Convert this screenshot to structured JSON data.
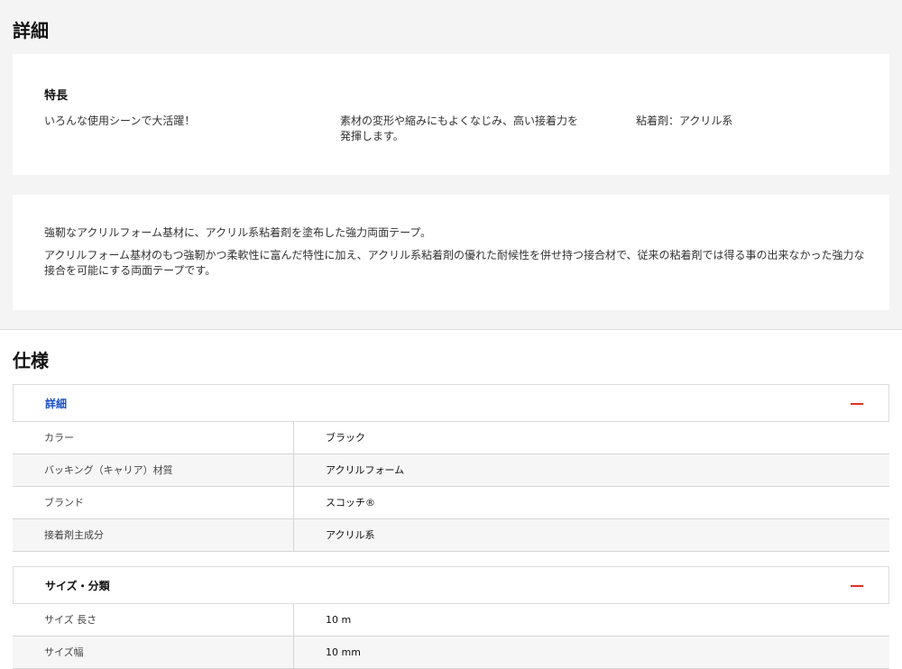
{
  "details": {
    "title": "詳細",
    "features_heading": "特長",
    "features": [
      "いろんな使用シーンで大活躍！",
      "素材の変形や縮みにもよくなじみ、高い接着力を発揮します。",
      "粘着剤：アクリル系"
    ],
    "description": [
      "強靭なアクリルフォーム基材に、アクリル系粘着剤を塗布した強力両面テープ。",
      "アクリルフォーム基材のもつ強靭かつ柔軟性に富んだ特性に加え、アクリル系粘着剤の優れた耐候性を併せ持つ接合材で、従来の粘着剤では得る事の出来なかった強力な接合を可能にする両面テープです。"
    ]
  },
  "specs": {
    "title": "仕様",
    "groups": [
      {
        "title": "詳細",
        "rows": [
          {
            "label": "カラー",
            "value": "ブラック"
          },
          {
            "label": "バッキング（キャリア）材質",
            "value": "アクリルフォーム"
          },
          {
            "label": "ブランド",
            "value": "スコッチ®"
          },
          {
            "label": "接着剤主成分",
            "value": "アクリル系"
          }
        ]
      },
      {
        "title": "サイズ・分類",
        "rows": [
          {
            "label": "サイズ 長さ",
            "value": "10 m"
          },
          {
            "label": "サイズ幅",
            "value": "10 mm"
          }
        ]
      }
    ]
  },
  "colors": {
    "accent_blue": "#1a4fc4",
    "collapse_red": "#e0302b",
    "section_bg": "#f4f4f4"
  },
  "icons": {
    "collapse": "minus-icon"
  }
}
